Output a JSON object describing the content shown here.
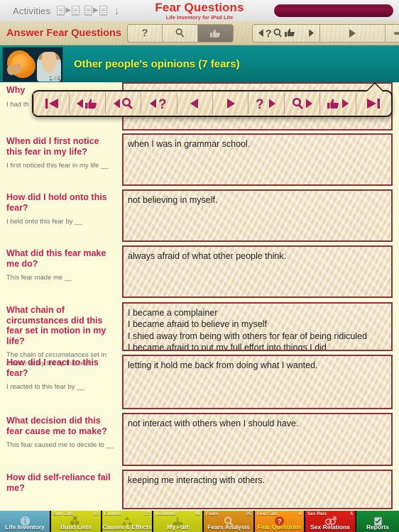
{
  "statusbar": {
    "activities_label": "Activities",
    "icons": [
      "doc-transfer-icon",
      "doc-transfer-icon",
      "download-arrow-icon"
    ]
  },
  "header": {
    "app_title": "Fear Questions",
    "app_subtitle": "Life Inventory for iPad Lite",
    "progress_pill": "progress-pill"
  },
  "toolbar": {
    "title": "Answer Fear Questions",
    "buttons": [
      {
        "name": "help-button",
        "glyph": "question-mark-icon",
        "active": false
      },
      {
        "name": "search-button",
        "glyph": "magnifier-icon",
        "active": false
      },
      {
        "name": "thumbs-up-button",
        "glyph": "thumbs-up-icon",
        "active": true
      },
      {
        "name": "nav-group-button",
        "glyph": "nav-cluster-icon",
        "active": false
      },
      {
        "name": "play-next-button",
        "glyph": "play-icon",
        "active": false
      },
      {
        "name": "tool-button",
        "glyph": "mallet-icon",
        "active": false
      }
    ]
  },
  "category": {
    "title": "Other people's opinions (7 fears)",
    "thumb_counter": "1 / 6",
    "thumb_name": "fear-category-photo"
  },
  "popover": {
    "buttons": [
      {
        "name": "first-record-button",
        "glyph": "skip-back-icon"
      },
      {
        "name": "prev-answered-button",
        "glyph": "back-thumb-icon"
      },
      {
        "name": "prev-search-button",
        "glyph": "back-magnifier-icon"
      },
      {
        "name": "prev-question-button",
        "glyph": "back-question-icon"
      },
      {
        "name": "previous-button",
        "glyph": "triangle-left-icon"
      },
      {
        "name": "next-button",
        "glyph": "triangle-right-icon"
      },
      {
        "name": "next-question-button",
        "glyph": "question-forward-icon"
      },
      {
        "name": "next-search-button",
        "glyph": "magnifier-forward-icon"
      },
      {
        "name": "next-answered-button",
        "glyph": "thumb-forward-icon"
      },
      {
        "name": "last-record-button",
        "glyph": "skip-forward-icon"
      }
    ]
  },
  "questions": [
    {
      "title": "Why",
      "hint": "I had th",
      "answer": ""
    },
    {
      "title": "When did I first notice this fear in my life?",
      "hint": "I first noticed this fear in my life __",
      "answer": "when I was in grammar school."
    },
    {
      "title": "How did I hold onto this fear?",
      "hint": "I held onto this fear by __",
      "answer": "not believing in myself."
    },
    {
      "title": "What did this fear make me do?",
      "hint": "This fear made me __",
      "answer": "always afraid of what other people think."
    },
    {
      "title": "What chain of circumstances did this fear set in motion in my life?",
      "hint": "The chain of circumstances set in motion in my life by this fear:",
      "answer": "I became a complainer\nI became afraid to believe in myself\nI shied away from being with others for fear of being ridiculed\nI became afraid to put my full effort into things I did"
    },
    {
      "title": "How did I react to this fear?",
      "hint": "I reacted to this fear by __",
      "answer": "letting it hold me back from doing what I wanted."
    },
    {
      "title": "What decision did this fear cause me to make?",
      "hint": "This fear caused me to decide to __",
      "answer": "not interact with others when I should have."
    },
    {
      "title": "How did self-reliance fail me?",
      "hint": "",
      "answer": "keeping me interacting with others."
    }
  ],
  "tabbar": [
    {
      "label": "Life Inventory",
      "badge_label": "",
      "count": "",
      "color": "#5ba3bc",
      "glyph": "info-icon",
      "selected": false
    },
    {
      "label": "Build Lists",
      "badge_label": "Sub Cats",
      "count": "13",
      "color": "#c9cf18",
      "glyph": "blocks-icon",
      "selected": false
    },
    {
      "label": "Causes & Effects",
      "badge_label": "Entities",
      "count": "27",
      "color": "#c9cf18",
      "glyph": "recycle-icon",
      "selected": false
    },
    {
      "label": "My Part",
      "badge_label": "Incidents",
      "count": "48",
      "color": "#c9cf18",
      "glyph": "anvil-icon",
      "selected": false
    },
    {
      "label": "Fears Analysis",
      "badge_label": "Fears",
      "count": "25",
      "color": "#d8891a",
      "glyph": "magnifier-icon",
      "selected": false
    },
    {
      "label": "Fear Questions",
      "badge_label": "Fear Cats",
      "count": "6",
      "color": "#f08a14",
      "glyph": "question-badge-icon",
      "selected": true
    },
    {
      "label": "Sex Relations",
      "badge_label": "Sex Rels",
      "count": "5",
      "color": "#d41a14",
      "glyph": "gender-icon",
      "selected": false
    },
    {
      "label": "Reports",
      "badge_label": "",
      "count": "",
      "color": "#117a2e",
      "glyph": "clipboard-icon",
      "selected": false
    }
  ],
  "colors": {
    "accent_red": "#d6231f",
    "question_pink": "#c51f54",
    "teal": "#07807f",
    "maroon": "#8c3040"
  }
}
